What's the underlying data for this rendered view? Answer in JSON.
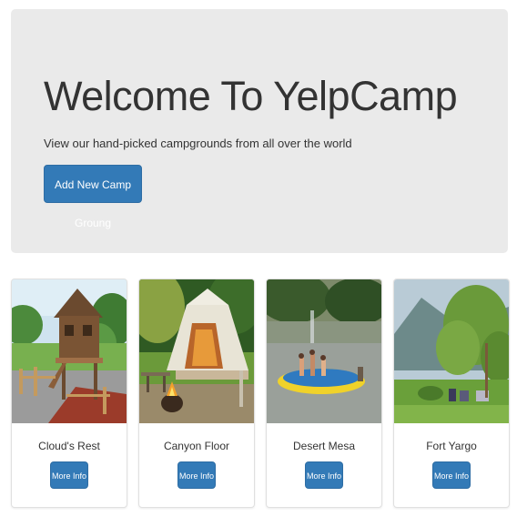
{
  "jumbotron": {
    "heading": "Welcome To YelpCamp",
    "subtitle": "View our hand-picked campgrounds from all over the world",
    "add_button_label": "Add New Camp Groung"
  },
  "campgrounds": [
    {
      "name": "Cloud's Rest",
      "button_label": "More Info",
      "image": "treehouse-cabin-photo"
    },
    {
      "name": "Canyon Floor",
      "button_label": "More Info",
      "image": "glamping-tent-campfire-photo"
    },
    {
      "name": "Desert Mesa",
      "button_label": "More Info",
      "image": "lake-trampoline-photo"
    },
    {
      "name": "Fort Yargo",
      "button_label": "More Info",
      "image": "park-meadow-trees-photo"
    }
  ],
  "colors": {
    "primary": "#337ab7",
    "jumbotron_bg": "#eaeaea"
  }
}
